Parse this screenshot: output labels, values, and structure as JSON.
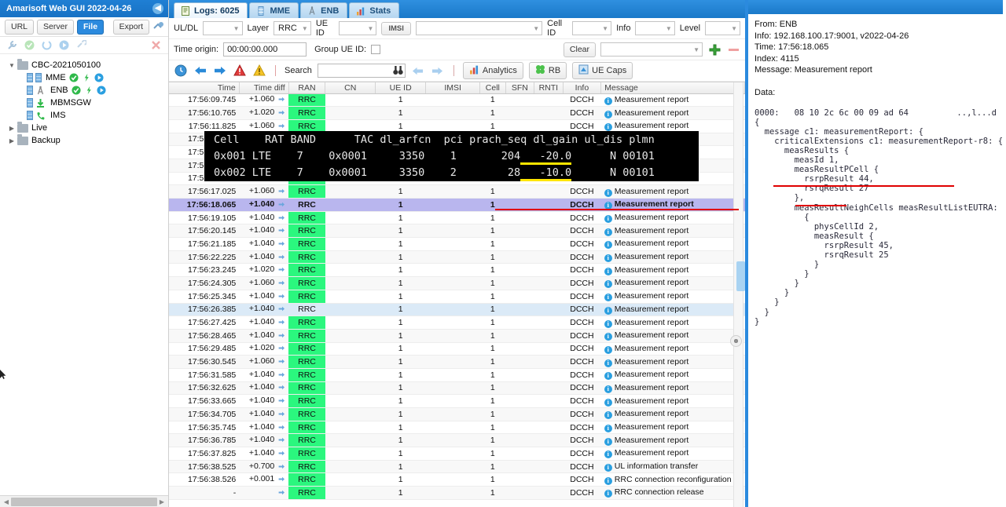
{
  "sidebar": {
    "title": "Amarisoft Web GUI 2022-04-26",
    "collapse_icon": "chevron-left-icon",
    "buttons": [
      {
        "label": "URL",
        "active": false
      },
      {
        "label": "Server",
        "active": false
      },
      {
        "label": "File",
        "active": true
      }
    ],
    "export_label": "Export",
    "add_icon": "add-server-icon",
    "tools": [
      "wrench-icon",
      "check-circle-icon",
      "refresh-icon",
      "play-circle-icon",
      "link-icon"
    ],
    "delete_icon": "delete-x-icon",
    "tree": [
      {
        "label": "CBC-2021050100",
        "type": "folder",
        "expanded": true,
        "depth": 0,
        "status": []
      },
      {
        "label": "MME",
        "type": "node",
        "depth": 1,
        "icon": "server-icon",
        "status": [
          "check-circle-icon",
          "bolt-icon",
          "play-circle-icon"
        ]
      },
      {
        "label": "ENB",
        "type": "node",
        "depth": 1,
        "icon": "antenna-icon",
        "status": [
          "check-circle-icon",
          "bolt-icon",
          "play-circle-icon"
        ]
      },
      {
        "label": "MBMSGW",
        "type": "node",
        "depth": 1,
        "icon": "download-icon",
        "status": []
      },
      {
        "label": "IMS",
        "type": "node",
        "depth": 1,
        "icon": "phone-icon",
        "status": []
      },
      {
        "label": "Live",
        "type": "folder",
        "expanded": false,
        "depth": 0,
        "status": []
      },
      {
        "label": "Backup",
        "type": "folder",
        "expanded": false,
        "depth": 0,
        "status": []
      }
    ]
  },
  "tabs": [
    {
      "label": "Logs: 6025",
      "icon": "logs-icon",
      "active": true
    },
    {
      "label": "MME",
      "icon": "server-icon",
      "active": false
    },
    {
      "label": "ENB",
      "icon": "antenna-icon",
      "active": false
    },
    {
      "label": "Stats",
      "icon": "chart-icon",
      "active": false
    }
  ],
  "filters": {
    "row1": [
      {
        "label": "UL/DL",
        "value": "",
        "name": "uldl-select"
      },
      {
        "label": "Layer",
        "value": "RRC",
        "name": "layer-select"
      },
      {
        "label": "UE ID",
        "value": "",
        "name": "ueid-select"
      }
    ],
    "imsi_button": "IMSI",
    "imsi_value": "",
    "cellid_label": "Cell ID",
    "cellid_value": "",
    "info_label": "Info",
    "info_value": "",
    "level_label": "Level",
    "level_value": "",
    "time_origin_label": "Time origin:",
    "time_origin_value": "00:00:00.000",
    "group_ue_label": "Group UE ID:",
    "group_ue_checked": false,
    "clear_label": "Clear",
    "preset_value": "",
    "add_icon": "plus-icon",
    "remove_icon": "minus-icon"
  },
  "toolbar": {
    "icons": [
      "clock-icon",
      "arrow-left-icon",
      "arrow-right-icon",
      "error-icon",
      "warning-icon"
    ],
    "search_label": "Search",
    "search_value": "",
    "binoculars_icon": "binoculars-icon",
    "prev_icon": "arrow-left-icon",
    "next_icon": "arrow-right-icon",
    "analytics_label": "Analytics",
    "analytics_icon": "chart-icon",
    "rb_label": "RB",
    "rb_icon": "rb-icon",
    "uecaps_label": "UE Caps",
    "uecaps_icon": "uecaps-icon"
  },
  "table": {
    "columns": [
      "Time",
      "Time diff",
      "RAN",
      "CN",
      "UE ID",
      "IMSI",
      "Cell",
      "SFN",
      "RNTI",
      "Info",
      "Message"
    ],
    "rows": [
      {
        "time": "17:56:09.745",
        "diff": "+1.060",
        "ran": "RRC",
        "cn": "",
        "ueid": "1",
        "imsi": "",
        "cell": "1",
        "sfn": "",
        "rnti": "",
        "info": "DCCH",
        "message": "Measurement report",
        "state": "normal"
      },
      {
        "time": "17:56:10.765",
        "diff": "+1.020",
        "ran": "RRC",
        "cn": "",
        "ueid": "1",
        "imsi": "",
        "cell": "1",
        "sfn": "",
        "rnti": "",
        "info": "DCCH",
        "message": "Measurement report",
        "state": "alt"
      },
      {
        "time": "17:56:11.825",
        "diff": "+1.060",
        "ran": "RRC",
        "cn": "",
        "ueid": "1",
        "imsi": "",
        "cell": "1",
        "sfn": "",
        "rnti": "",
        "info": "DCCH",
        "message": "Measurement report",
        "state": "normal"
      },
      {
        "time": "17:56:12.845",
        "diff": "",
        "ran": "RRC",
        "cn": "",
        "ueid": "",
        "imsi": "",
        "cell": "",
        "sfn": "",
        "rnti": "",
        "info": "",
        "message": "",
        "state": "alt"
      },
      {
        "time": "17:56:13.885",
        "diff": "",
        "ran": "RRC",
        "cn": "",
        "ueid": "",
        "imsi": "",
        "cell": "",
        "sfn": "",
        "rnti": "",
        "info": "",
        "message": "",
        "state": "normal"
      },
      {
        "time": "17:56:14.945",
        "diff": "",
        "ran": "RRC",
        "cn": "",
        "ueid": "",
        "imsi": "",
        "cell": "",
        "sfn": "",
        "rnti": "",
        "info": "",
        "message": "",
        "state": "alt"
      },
      {
        "time": "17:56:15.965",
        "diff": "",
        "ran": "RRC",
        "cn": "",
        "ueid": "",
        "imsi": "",
        "cell": "",
        "sfn": "",
        "rnti": "",
        "info": "",
        "message": "",
        "state": "normal"
      },
      {
        "time": "17:56:17.025",
        "diff": "+1.060",
        "ran": "RRC",
        "cn": "",
        "ueid": "1",
        "imsi": "",
        "cell": "1",
        "sfn": "",
        "rnti": "",
        "info": "DCCH",
        "message": "Measurement report",
        "state": "alt"
      },
      {
        "time": "17:56:18.065",
        "diff": "+1.040",
        "ran": "RRC",
        "cn": "",
        "ueid": "1",
        "imsi": "",
        "cell": "1",
        "sfn": "",
        "rnti": "",
        "info": "DCCH",
        "message": "Measurement report",
        "state": "selected"
      },
      {
        "time": "17:56:19.105",
        "diff": "+1.040",
        "ran": "RRC",
        "cn": "",
        "ueid": "1",
        "imsi": "",
        "cell": "1",
        "sfn": "",
        "rnti": "",
        "info": "DCCH",
        "message": "Measurement report",
        "state": "normal"
      },
      {
        "time": "17:56:20.145",
        "diff": "+1.040",
        "ran": "RRC",
        "cn": "",
        "ueid": "1",
        "imsi": "",
        "cell": "1",
        "sfn": "",
        "rnti": "",
        "info": "DCCH",
        "message": "Measurement report",
        "state": "alt"
      },
      {
        "time": "17:56:21.185",
        "diff": "+1.040",
        "ran": "RRC",
        "cn": "",
        "ueid": "1",
        "imsi": "",
        "cell": "1",
        "sfn": "",
        "rnti": "",
        "info": "DCCH",
        "message": "Measurement report",
        "state": "normal"
      },
      {
        "time": "17:56:22.225",
        "diff": "+1.040",
        "ran": "RRC",
        "cn": "",
        "ueid": "1",
        "imsi": "",
        "cell": "1",
        "sfn": "",
        "rnti": "",
        "info": "DCCH",
        "message": "Measurement report",
        "state": "alt"
      },
      {
        "time": "17:56:23.245",
        "diff": "+1.020",
        "ran": "RRC",
        "cn": "",
        "ueid": "1",
        "imsi": "",
        "cell": "1",
        "sfn": "",
        "rnti": "",
        "info": "DCCH",
        "message": "Measurement report",
        "state": "normal"
      },
      {
        "time": "17:56:24.305",
        "diff": "+1.060",
        "ran": "RRC",
        "cn": "",
        "ueid": "1",
        "imsi": "",
        "cell": "1",
        "sfn": "",
        "rnti": "",
        "info": "DCCH",
        "message": "Measurement report",
        "state": "alt"
      },
      {
        "time": "17:56:25.345",
        "diff": "+1.040",
        "ran": "RRC",
        "cn": "",
        "ueid": "1",
        "imsi": "",
        "cell": "1",
        "sfn": "",
        "rnti": "",
        "info": "DCCH",
        "message": "Measurement report",
        "state": "normal"
      },
      {
        "time": "17:56:26.385",
        "diff": "+1.040",
        "ran": "RRC",
        "cn": "",
        "ueid": "1",
        "imsi": "",
        "cell": "1",
        "sfn": "",
        "rnti": "",
        "info": "DCCH",
        "message": "Measurement report",
        "state": "hover"
      },
      {
        "time": "17:56:27.425",
        "diff": "+1.040",
        "ran": "RRC",
        "cn": "",
        "ueid": "1",
        "imsi": "",
        "cell": "1",
        "sfn": "",
        "rnti": "",
        "info": "DCCH",
        "message": "Measurement report",
        "state": "normal"
      },
      {
        "time": "17:56:28.465",
        "diff": "+1.040",
        "ran": "RRC",
        "cn": "",
        "ueid": "1",
        "imsi": "",
        "cell": "1",
        "sfn": "",
        "rnti": "",
        "info": "DCCH",
        "message": "Measurement report",
        "state": "alt"
      },
      {
        "time": "17:56:29.485",
        "diff": "+1.020",
        "ran": "RRC",
        "cn": "",
        "ueid": "1",
        "imsi": "",
        "cell": "1",
        "sfn": "",
        "rnti": "",
        "info": "DCCH",
        "message": "Measurement report",
        "state": "normal"
      },
      {
        "time": "17:56:30.545",
        "diff": "+1.060",
        "ran": "RRC",
        "cn": "",
        "ueid": "1",
        "imsi": "",
        "cell": "1",
        "sfn": "",
        "rnti": "",
        "info": "DCCH",
        "message": "Measurement report",
        "state": "alt"
      },
      {
        "time": "17:56:31.585",
        "diff": "+1.040",
        "ran": "RRC",
        "cn": "",
        "ueid": "1",
        "imsi": "",
        "cell": "1",
        "sfn": "",
        "rnti": "",
        "info": "DCCH",
        "message": "Measurement report",
        "state": "normal"
      },
      {
        "time": "17:56:32.625",
        "diff": "+1.040",
        "ran": "RRC",
        "cn": "",
        "ueid": "1",
        "imsi": "",
        "cell": "1",
        "sfn": "",
        "rnti": "",
        "info": "DCCH",
        "message": "Measurement report",
        "state": "alt"
      },
      {
        "time": "17:56:33.665",
        "diff": "+1.040",
        "ran": "RRC",
        "cn": "",
        "ueid": "1",
        "imsi": "",
        "cell": "1",
        "sfn": "",
        "rnti": "",
        "info": "DCCH",
        "message": "Measurement report",
        "state": "normal"
      },
      {
        "time": "17:56:34.705",
        "diff": "+1.040",
        "ran": "RRC",
        "cn": "",
        "ueid": "1",
        "imsi": "",
        "cell": "1",
        "sfn": "",
        "rnti": "",
        "info": "DCCH",
        "message": "Measurement report",
        "state": "alt"
      },
      {
        "time": "17:56:35.745",
        "diff": "+1.040",
        "ran": "RRC",
        "cn": "",
        "ueid": "1",
        "imsi": "",
        "cell": "1",
        "sfn": "",
        "rnti": "",
        "info": "DCCH",
        "message": "Measurement report",
        "state": "normal"
      },
      {
        "time": "17:56:36.785",
        "diff": "+1.040",
        "ran": "RRC",
        "cn": "",
        "ueid": "1",
        "imsi": "",
        "cell": "1",
        "sfn": "",
        "rnti": "",
        "info": "DCCH",
        "message": "Measurement report",
        "state": "alt"
      },
      {
        "time": "17:56:37.825",
        "diff": "+1.040",
        "ran": "RRC",
        "cn": "",
        "ueid": "1",
        "imsi": "",
        "cell": "1",
        "sfn": "",
        "rnti": "",
        "info": "DCCH",
        "message": "Measurement report",
        "state": "normal"
      },
      {
        "time": "17:56:38.525",
        "diff": "+0.700",
        "ran": "RRC",
        "cn": "",
        "ueid": "1",
        "imsi": "",
        "cell": "1",
        "sfn": "",
        "rnti": "",
        "info": "DCCH",
        "message": "UL information transfer",
        "state": "alt"
      },
      {
        "time": "17:56:38.526",
        "diff": "+0.001",
        "ran": "RRC",
        "cn": "",
        "ueid": "1",
        "imsi": "",
        "cell": "1",
        "sfn": "",
        "rnti": "",
        "info": "DCCH",
        "message": "RRC connection reconfiguration",
        "state": "normal"
      },
      {
        "time": "-",
        "diff": "",
        "ran": "RRC",
        "cn": "",
        "ueid": "1",
        "imsi": "",
        "cell": "1",
        "sfn": "",
        "rnti": "",
        "info": "DCCH",
        "message": "RRC connection release",
        "state": "alt"
      }
    ]
  },
  "terminal": {
    "header": "Cell    RAT BAND      TAC dl_arfcn  pci prach_seq dl_gain ul_dis plmn",
    "rows": [
      {
        "cell": "0x001",
        "rat": "LTE",
        "band": "7",
        "tac": "0x0001",
        "dl_arfcn": "3350",
        "pci": "1",
        "prach_seq": "204",
        "dl_gain": "-20.0",
        "ul_dis": "N",
        "plmn": "00101"
      },
      {
        "cell": "0x002",
        "rat": "LTE",
        "band": "7",
        "tac": "0x0001",
        "dl_arfcn": "3350",
        "pci": "2",
        "prach_seq": "28",
        "dl_gain": "-10.0",
        "ul_dis": "N",
        "plmn": "00101"
      }
    ],
    "highlight_color": "#ffe600"
  },
  "detail": {
    "from_line": "From: ENB",
    "info_line": "Info: 192.168.100.17:9001, v2022-04-26",
    "time_line": "Time: 17:56:18.065",
    "index_line": "Index: 4115",
    "message_line": "Message: Measurement report",
    "data_label": "Data:",
    "hex_offset": "0000:   08 10 2c 6c 00 09 ad 64",
    "hex_ascii": "..,l...d",
    "asn_lines": [
      "{",
      "  message c1: measurementReport: {",
      "    criticalExtensions c1: measurementReport-r8: {",
      "      measResults {",
      "        measId 1,",
      "        measResultPCell {",
      "          rsrpResult 44,",
      "          rsrqResult 27",
      "        },",
      "        measResultNeighCells measResultListEUTRA: {",
      "          {",
      "            physCellId 2,",
      "            measResult {",
      "              rsrpResult 45,",
      "              rsrqResult 25",
      "            }",
      "          }",
      "        }",
      "      }",
      "    }",
      "  }",
      "}"
    ]
  },
  "annotations": {
    "color": "#e00000",
    "underline_selected_row": true,
    "underline_meas_neigh": true,
    "underline_physcellid": true
  }
}
